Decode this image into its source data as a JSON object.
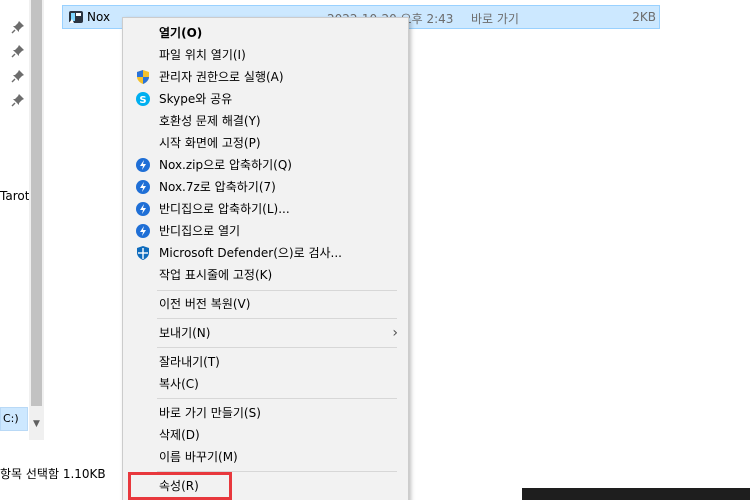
{
  "file": {
    "name": "Nox",
    "date": "2022-10-20 오후 2:43",
    "type": "바로 가기",
    "size": "2KB"
  },
  "nav": {
    "partial_item": "Tarot",
    "selected_item": "C:)"
  },
  "status": {
    "selection": "항목 선택함 1.10KB"
  },
  "menu": {
    "open": "열기(O)",
    "open_location": "파일 위치 열기(I)",
    "run_as_admin": "관리자 권한으로 실행(A)",
    "skype_share": "Skype와 공유",
    "troubleshoot": "호환성 문제 해결(Y)",
    "pin_start": "시작 화면에 고정(P)",
    "compress_zip": "Nox.zip으로 압축하기(Q)",
    "compress_7z": "Nox.7z로 압축하기(7)",
    "bandizip_compress": "반디집으로 압축하기(L)...",
    "bandizip_open": "반디집으로 열기",
    "defender_scan": "Microsoft Defender(으)로 검사...",
    "pin_taskbar": "작업 표시줄에 고정(K)",
    "restore_previous": "이전 버전 복원(V)",
    "send_to": "보내기(N)",
    "cut": "잘라내기(T)",
    "copy": "복사(C)",
    "create_shortcut": "바로 가기 만들기(S)",
    "delete": "삭제(D)",
    "rename": "이름 바꾸기(M)",
    "properties": "속성(R)"
  },
  "colors": {
    "selection": "#cce8ff",
    "highlight_border": "#e8383d",
    "bandizip": "#1f6fd6",
    "skype": "#00aff0",
    "defender": "#0f6cbd"
  }
}
